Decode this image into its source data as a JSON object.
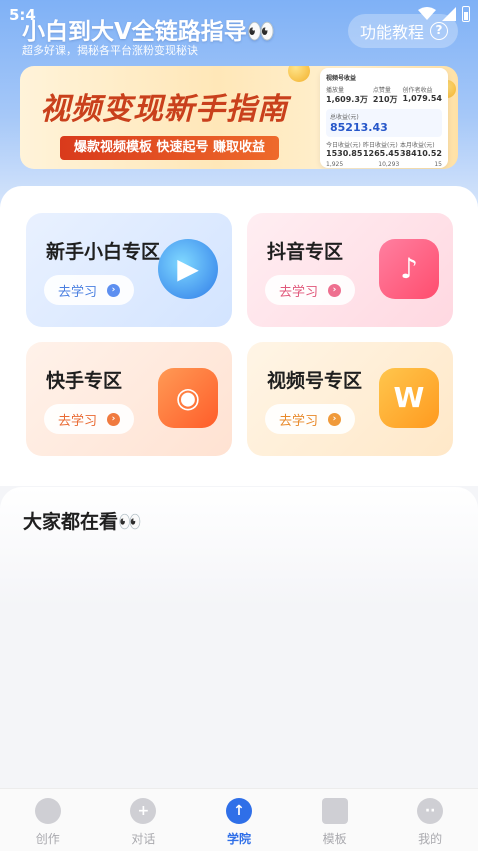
{
  "status_bar": {
    "time": "5:4"
  },
  "header": {
    "title": "小白到大V全链路指导👀",
    "subtitle": "超多好课，揭秘各平台涨粉变现秘诀",
    "tutorial_label": "功能教程",
    "help_glyph": "?"
  },
  "banner": {
    "title": "视频变现新手指南",
    "tags": "爆款视频模板  快速起号  赚取收益",
    "card": {
      "header": "视频号收益",
      "stat1_label": "播放量",
      "stat1_value": "1,609.3万",
      "stat2_label": "点赞量",
      "stat2_value": "210万",
      "stat3_label": "创作者收益",
      "stat3_value": "1,079.54",
      "earn_label": "总收益(元)",
      "earn_value": "85213.43",
      "r1_label": "今日收益(元)",
      "r1_value": "1530.85",
      "r2_label": "昨日收益(元)",
      "r2_value": "1265.45",
      "r3_label": "本月收益(元)",
      "r3_value": "38410.52",
      "f1": "1,925",
      "f2": "10,293",
      "f3": "15"
    }
  },
  "zones": [
    {
      "name": "新手小白专区",
      "button": "去学习"
    },
    {
      "name": "抖音专区",
      "button": "去学习"
    },
    {
      "name": "快手专区",
      "button": "去学习"
    },
    {
      "name": "视频号专区",
      "button": "去学习"
    }
  ],
  "watching": {
    "title": "大家都在看👀"
  },
  "tabbar": [
    {
      "label": "创作",
      "icon": "create-icon"
    },
    {
      "label": "对话",
      "icon": "chat-icon"
    },
    {
      "label": "学院",
      "icon": "academy-icon",
      "active": true
    },
    {
      "label": "模板",
      "icon": "template-icon"
    },
    {
      "label": "我的",
      "icon": "profile-icon"
    }
  ],
  "colors": {
    "accent": "#2f6fe8",
    "banner_red": "#c9401c"
  }
}
